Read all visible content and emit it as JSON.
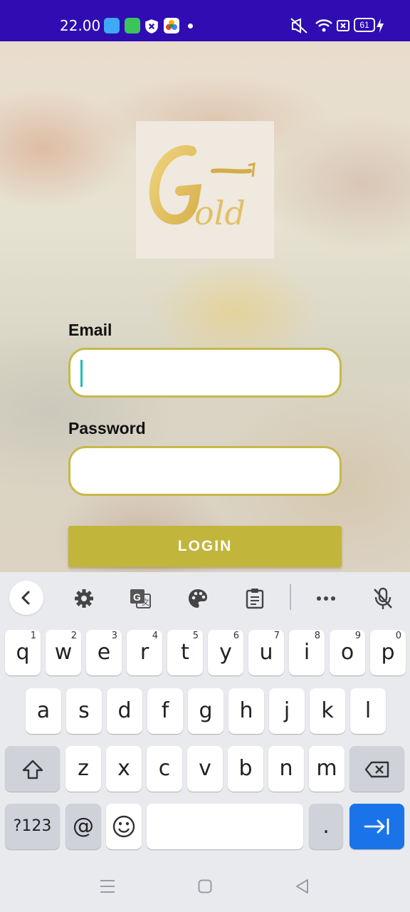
{
  "status_bar": {
    "time": "22.00",
    "battery": "61",
    "icons": [
      "app-blue-icon",
      "app-green-icon",
      "shield-icon",
      "photos-icon",
      "notification-dot",
      "mute-vibrate-icon",
      "wifi-icon",
      "sim-icon",
      "battery-icon",
      "charging-icon"
    ]
  },
  "logo": {
    "text": "Gold",
    "color": "#e7c86b"
  },
  "form": {
    "email_label": "Email",
    "email_value": "",
    "password_label": "Password",
    "password_value": "",
    "login_label": "LOGIN",
    "accent": "#c2b53b"
  },
  "keyboard": {
    "toolbar": [
      "back-icon",
      "settings-icon",
      "translate-icon",
      "palette-icon",
      "clipboard-icon",
      "more-icon",
      "mic-off-icon"
    ],
    "row1": [
      {
        "k": "q",
        "h": "1"
      },
      {
        "k": "w",
        "h": "2"
      },
      {
        "k": "e",
        "h": "3"
      },
      {
        "k": "r",
        "h": "4"
      },
      {
        "k": "t",
        "h": "5"
      },
      {
        "k": "y",
        "h": "6"
      },
      {
        "k": "u",
        "h": "7"
      },
      {
        "k": "i",
        "h": "8"
      },
      {
        "k": "o",
        "h": "9"
      },
      {
        "k": "p",
        "h": "0"
      }
    ],
    "row2": [
      "a",
      "s",
      "d",
      "f",
      "g",
      "h",
      "j",
      "k",
      "l"
    ],
    "row3": [
      "z",
      "x",
      "c",
      "v",
      "b",
      "n",
      "m"
    ],
    "symbols_label": "?123",
    "at_label": "@",
    "period_label": ".",
    "enter_color": "#1a73e8"
  },
  "nav": [
    "recents-icon",
    "home-icon",
    "back-icon"
  ]
}
